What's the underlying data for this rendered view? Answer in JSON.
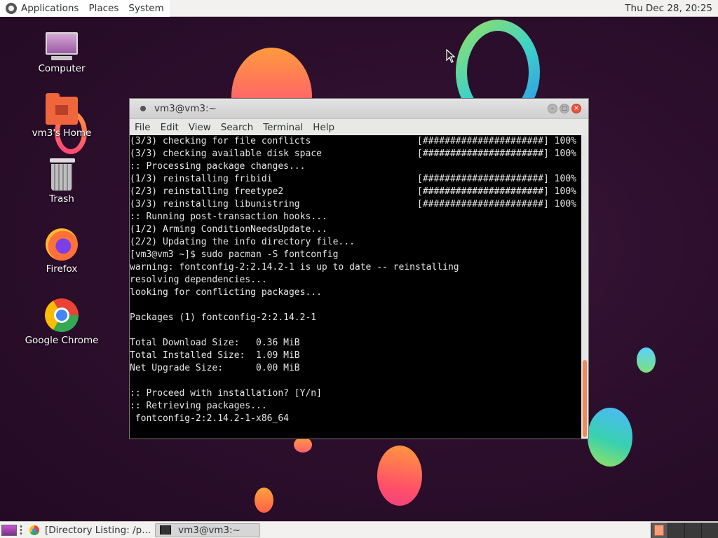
{
  "top_panel": {
    "menus": [
      "Applications",
      "Places",
      "System"
    ],
    "clock": "Thu Dec 28, 20:25"
  },
  "desktop_icons": [
    {
      "label": "Computer",
      "icon": "computer-icon"
    },
    {
      "label": "vm3's Home",
      "icon": "home-folder-icon"
    },
    {
      "label": "Trash",
      "icon": "trash-icon"
    },
    {
      "label": "Firefox",
      "icon": "firefox-icon"
    },
    {
      "label": "Google Chrome",
      "icon": "chrome-icon"
    }
  ],
  "terminal": {
    "title": "vm3@vm3:~",
    "menu": [
      "File",
      "Edit",
      "View",
      "Search",
      "Terminal",
      "Help"
    ],
    "lines": [
      {
        "text": "(3/3) checking for file conflicts",
        "progress": "[######################] 100%"
      },
      {
        "text": "(3/3) checking available disk space",
        "progress": "[######################] 100%"
      },
      {
        "text": ":: Processing package changes...",
        "progress": ""
      },
      {
        "text": "(1/3) reinstalling fribidi",
        "progress": "[######################] 100%"
      },
      {
        "text": "(2/3) reinstalling freetype2",
        "progress": "[######################] 100%"
      },
      {
        "text": "(3/3) reinstalling libunistring",
        "progress": "[######################] 100%"
      },
      {
        "text": ":: Running post-transaction hooks...",
        "progress": ""
      },
      {
        "text": "(1/2) Arming ConditionNeedsUpdate...",
        "progress": ""
      },
      {
        "text": "(2/2) Updating the info directory file...",
        "progress": ""
      },
      {
        "text": "[vm3@vm3 ~]$ sudo pacman -S fontconfig",
        "progress": ""
      },
      {
        "text": "warning: fontconfig-2:2.14.2-1 is up to date -- reinstalling",
        "progress": ""
      },
      {
        "text": "resolving dependencies...",
        "progress": ""
      },
      {
        "text": "looking for conflicting packages...",
        "progress": ""
      },
      {
        "text": "",
        "progress": ""
      },
      {
        "text": "Packages (1) fontconfig-2:2.14.2-1",
        "progress": ""
      },
      {
        "text": "",
        "progress": ""
      },
      {
        "text": "Total Download Size:   0.36 MiB",
        "progress": ""
      },
      {
        "text": "Total Installed Size:  1.09 MiB",
        "progress": ""
      },
      {
        "text": "Net Upgrade Size:      0.00 MiB",
        "progress": ""
      },
      {
        "text": "",
        "progress": ""
      },
      {
        "text": ":: Proceed with installation? [Y/n]",
        "progress": ""
      },
      {
        "text": ":: Retrieving packages...",
        "progress": ""
      },
      {
        "text": " fontconfig-2:2.14.2-1-x86_64",
        "progress": ""
      }
    ]
  },
  "taskbar": {
    "tasks": [
      {
        "label": "[Directory Listing: /p...",
        "icon": "chrome-icon",
        "active": false
      },
      {
        "label": "vm3@vm3:~",
        "icon": "terminal-icon",
        "active": true
      }
    ],
    "workspaces": 4,
    "active_workspace": 1
  },
  "colors": {
    "accent": "#f08a5d",
    "close_button": "#e9543e",
    "terminal_bg": "#000000"
  }
}
